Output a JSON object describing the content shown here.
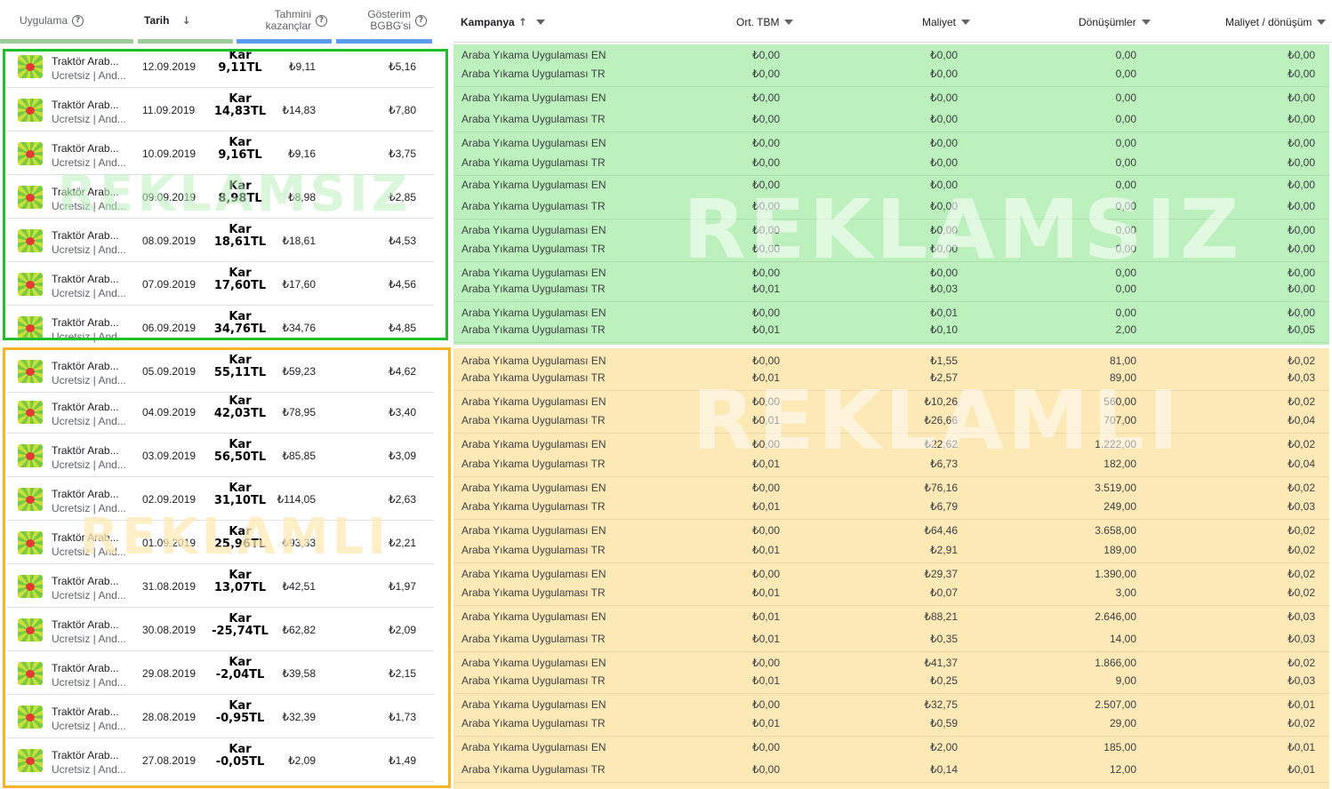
{
  "left_header": {
    "app": "Uygulama",
    "date": "Tarih",
    "earnings": "Tahmini kazançlar",
    "bgbg": "Gösterim BGBG'si"
  },
  "watermarks": {
    "no_ads": "REKLAMSIZ",
    "ads": "REKLAMLI"
  },
  "left_rows": [
    {
      "name": "Traktör Arab...",
      "sub": "Ucretsiz | And...",
      "date": "12.09.2019",
      "kar": "Kar",
      "profit": "9,11TL",
      "earn": "₺9,11",
      "bgbg": "₺5,16"
    },
    {
      "name": "Traktör Arab...",
      "sub": "Ucretsiz | And...",
      "date": "11.09.2019",
      "kar": "Kar",
      "profit": "14,83TL",
      "earn": "₺14,83",
      "bgbg": "₺7,80"
    },
    {
      "name": "Traktör Arab...",
      "sub": "Ucretsiz | And...",
      "date": "10.09.2019",
      "kar": "Kar",
      "profit": "9,16TL",
      "earn": "₺9,16",
      "bgbg": "₺3,75"
    },
    {
      "name": "Traktör Arab...",
      "sub": "Ucretsiz | And...",
      "date": "09.09.2019",
      "kar": "Kar",
      "profit": "8,98TL",
      "earn": "₺8,98",
      "bgbg": "₺2,85"
    },
    {
      "name": "Traktör Arab...",
      "sub": "Ucretsiz | And...",
      "date": "08.09.2019",
      "kar": "Kar",
      "profit": "18,61TL",
      "earn": "₺18,61",
      "bgbg": "₺4,53"
    },
    {
      "name": "Traktör Arab...",
      "sub": "Ucretsiz | And...",
      "date": "07.09.2019",
      "kar": "Kar",
      "profit": "17,60TL",
      "earn": "₺17,60",
      "bgbg": "₺4,56"
    },
    {
      "name": "Traktör Arab...",
      "sub": "Ucretsiz | And...",
      "date": "06.09.2019",
      "kar": "Kar",
      "profit": "34,76TL",
      "earn": "₺34,76",
      "bgbg": "₺4,85"
    },
    {
      "name": "Traktör Arab...",
      "sub": "Ucretsiz | And...",
      "date": "05.09.2019",
      "kar": "Kar",
      "profit": "55,11TL",
      "earn": "₺59,23",
      "bgbg": "₺4,62"
    },
    {
      "name": "Traktör Arab...",
      "sub": "Ucretsiz | And...",
      "date": "04.09.2019",
      "kar": "Kar",
      "profit": "42,03TL",
      "earn": "₺78,95",
      "bgbg": "₺3,40"
    },
    {
      "name": "Traktör Arab...",
      "sub": "Ucretsiz | And...",
      "date": "03.09.2019",
      "kar": "Kar",
      "profit": "56,50TL",
      "earn": "₺85,85",
      "bgbg": "₺3,09"
    },
    {
      "name": "Traktör Arab...",
      "sub": "Ucretsiz | And...",
      "date": "02.09.2019",
      "kar": "Kar",
      "profit": "31,10TL",
      "earn": "₺114,05",
      "bgbg": "₺2,63"
    },
    {
      "name": "Traktör Arab...",
      "sub": "Ucretsiz | And...",
      "date": "01.09.2019",
      "kar": "Kar",
      "profit": "25,96TL",
      "earn": "₺93,33",
      "bgbg": "₺2,21"
    },
    {
      "name": "Traktör Arab...",
      "sub": "Ucretsiz | And...",
      "date": "31.08.2019",
      "kar": "Kar",
      "profit": "13,07TL",
      "earn": "₺42,51",
      "bgbg": "₺1,97"
    },
    {
      "name": "Traktör Arab...",
      "sub": "Ucretsiz | And...",
      "date": "30.08.2019",
      "kar": "Kar",
      "profit": "-25,74TL",
      "earn": "₺62,82",
      "bgbg": "₺2,09"
    },
    {
      "name": "Traktör Arab...",
      "sub": "Ucretsiz | And...",
      "date": "29.08.2019",
      "kar": "Kar",
      "profit": "-2,04TL",
      "earn": "₺39,58",
      "bgbg": "₺2,15"
    },
    {
      "name": "Traktör Arab...",
      "sub": "Ucretsiz | And...",
      "date": "28.08.2019",
      "kar": "Kar",
      "profit": "-0,95TL",
      "earn": "₺32,39",
      "bgbg": "₺1,73"
    },
    {
      "name": "Traktör Arab...",
      "sub": "Ucretsiz | And...",
      "date": "27.08.2019",
      "kar": "Kar",
      "profit": "-0,05TL",
      "earn": "₺2,09",
      "bgbg": "₺1,49"
    }
  ],
  "right_header": {
    "campaign": "Kampanya",
    "tbm": "Ort. TBM",
    "cost": "Maliyet",
    "conversions": "Dönüşümler",
    "cpc": "Maliyet / dönüşüm"
  },
  "campaign_rows": [
    {
      "group": "green",
      "lines": [
        {
          "name": "Araba Yıkama Uygulaması EN",
          "tbm": "₺0,00",
          "cost": "₺0,00",
          "conv": "0,00",
          "cpc": "₺0,00"
        },
        {
          "name": "Araba Yıkama Uygulaması TR",
          "tbm": "₺0,00",
          "cost": "₺0,00",
          "conv": "0,00",
          "cpc": "₺0,00"
        }
      ]
    },
    {
      "group": "green",
      "lines": [
        {
          "name": "Araba Yıkama Uygulaması EN",
          "tbm": "₺0,00",
          "cost": "₺0,00",
          "conv": "0,00",
          "cpc": "₺0,00"
        },
        {
          "name": "Araba Yıkama Uygulaması TR",
          "tbm": "₺0,00",
          "cost": "₺0,00",
          "conv": "0,00",
          "cpc": "₺0,00"
        }
      ]
    },
    {
      "group": "green",
      "lines": [
        {
          "name": "Araba Yıkama Uygulaması EN",
          "tbm": "₺0,00",
          "cost": "₺0,00",
          "conv": "0,00",
          "cpc": "₺0,00"
        },
        {
          "name": "Araba Yıkama Uygulaması TR",
          "tbm": "₺0,00",
          "cost": "₺0,00",
          "conv": "0,00",
          "cpc": "₺0,00"
        }
      ]
    },
    {
      "group": "green",
      "lines": [
        {
          "name": "Araba Yıkama Uygulaması EN",
          "tbm": "₺0,00",
          "cost": "₺0,00",
          "conv": "0,00",
          "cpc": "₺0,00"
        },
        {
          "name": "Araba Yıkama Uygulaması TR",
          "tbm": "₺0,00",
          "cost": "₺0,00",
          "conv": "0,00",
          "cpc": "₺0,00"
        }
      ]
    },
    {
      "group": "green",
      "lines": [
        {
          "name": "Araba Yıkama Uygulaması EN",
          "tbm": "₺0,00",
          "cost": "₺0,00",
          "conv": "0,00",
          "cpc": "₺0,00"
        },
        {
          "name": "Araba Yıkama Uygulaması TR",
          "tbm": "₺0,00",
          "cost": "₺0,00",
          "conv": "0,00",
          "cpc": "₺0,00"
        }
      ]
    },
    {
      "group": "green",
      "lines": [
        {
          "name": "Araba Yıkama Uygulaması EN",
          "tbm": "₺0,00",
          "cost": "₺0,00",
          "conv": "0,00",
          "cpc": "₺0,00"
        },
        {
          "name": "Araba Yıkama Uygulaması TR",
          "tbm": "₺0,01",
          "cost": "₺0,03",
          "conv": "0,00",
          "cpc": "₺0,00"
        }
      ]
    },
    {
      "group": "green",
      "lines": [
        {
          "name": "Araba Yıkama Uygulaması EN",
          "tbm": "₺0,00",
          "cost": "₺0,01",
          "conv": "0,00",
          "cpc": "₺0,00"
        },
        {
          "name": "Araba Yıkama Uygulaması TR",
          "tbm": "₺0,01",
          "cost": "₺0,10",
          "conv": "2,00",
          "cpc": "₺0,05"
        }
      ]
    },
    {
      "group": "orange",
      "lines": [
        {
          "name": "Araba Yıkama Uygulaması EN",
          "tbm": "₺0,00",
          "cost": "₺1,55",
          "conv": "81,00",
          "cpc": "₺0,02"
        },
        {
          "name": "Araba Yıkama Uygulaması TR",
          "tbm": "₺0,01",
          "cost": "₺2,57",
          "conv": "89,00",
          "cpc": "₺0,03"
        }
      ]
    },
    {
      "group": "orange",
      "lines": [
        {
          "name": "Araba Yıkama Uygulaması EN",
          "tbm": "₺0,00",
          "cost": "₺10,26",
          "conv": "560,00",
          "cpc": "₺0,02"
        },
        {
          "name": "Araba Yıkama Uygulaması TR",
          "tbm": "₺0,01",
          "cost": "₺26,66",
          "conv": "707,00",
          "cpc": "₺0,04"
        }
      ]
    },
    {
      "group": "orange",
      "lines": [
        {
          "name": "Araba Yıkama Uygulaması EN",
          "tbm": "₺0,00",
          "cost": "₺22,62",
          "conv": "1.222,00",
          "cpc": "₺0,02"
        },
        {
          "name": "Araba Yıkama Uygulaması TR",
          "tbm": "₺0,01",
          "cost": "₺6,73",
          "conv": "182,00",
          "cpc": "₺0,04"
        }
      ]
    },
    {
      "group": "orange",
      "lines": [
        {
          "name": "Araba Yıkama Uygulaması EN",
          "tbm": "₺0,00",
          "cost": "₺76,16",
          "conv": "3.519,00",
          "cpc": "₺0,02"
        },
        {
          "name": "Araba Yıkama Uygulaması TR",
          "tbm": "₺0,01",
          "cost": "₺6,79",
          "conv": "249,00",
          "cpc": "₺0,03"
        }
      ]
    },
    {
      "group": "orange",
      "lines": [
        {
          "name": "Araba Yıkama Uygulaması EN",
          "tbm": "₺0,00",
          "cost": "₺64,46",
          "conv": "3.658,00",
          "cpc": "₺0,02"
        },
        {
          "name": "Araba Yıkama Uygulaması TR",
          "tbm": "₺0,01",
          "cost": "₺2,91",
          "conv": "189,00",
          "cpc": "₺0,02"
        }
      ]
    },
    {
      "group": "orange",
      "lines": [
        {
          "name": "Araba Yıkama Uygulaması EN",
          "tbm": "₺0,00",
          "cost": "₺29,37",
          "conv": "1.390,00",
          "cpc": "₺0,02"
        },
        {
          "name": "Araba Yıkama Uygulaması TR",
          "tbm": "₺0,01",
          "cost": "₺0,07",
          "conv": "3,00",
          "cpc": "₺0,02"
        }
      ]
    },
    {
      "group": "orange",
      "lines": [
        {
          "name": "Araba Yıkama Uygulaması EN",
          "tbm": "₺0,01",
          "cost": "₺88,21",
          "conv": "2.646,00",
          "cpc": "₺0,03"
        },
        {
          "name": "Araba Yıkama Uygulaması TR",
          "tbm": "₺0,01",
          "cost": "₺0,35",
          "conv": "14,00",
          "cpc": "₺0,03"
        }
      ]
    },
    {
      "group": "orange",
      "lines": [
        {
          "name": "Araba Yıkama Uygulaması EN",
          "tbm": "₺0,00",
          "cost": "₺41,37",
          "conv": "1.866,00",
          "cpc": "₺0,02"
        },
        {
          "name": "Araba Yıkama Uygulaması TR",
          "tbm": "₺0,01",
          "cost": "₺0,25",
          "conv": "9,00",
          "cpc": "₺0,03"
        }
      ]
    },
    {
      "group": "orange",
      "lines": [
        {
          "name": "Araba Yıkama Uygulaması EN",
          "tbm": "₺0,00",
          "cost": "₺32,75",
          "conv": "2.507,00",
          "cpc": "₺0,01"
        },
        {
          "name": "Araba Yıkama Uygulaması TR",
          "tbm": "₺0,01",
          "cost": "₺0,59",
          "conv": "29,00",
          "cpc": "₺0,02"
        }
      ]
    },
    {
      "group": "orange",
      "lines": [
        {
          "name": "Araba Yıkama Uygulaması EN",
          "tbm": "₺0,00",
          "cost": "₺2,00",
          "conv": "185,00",
          "cpc": "₺0,01"
        },
        {
          "name": "Araba Yıkama Uygulaması TR",
          "tbm": "₺0,00",
          "cost": "₺0,14",
          "conv": "12,00",
          "cpc": "₺0,01"
        }
      ]
    }
  ],
  "colors": {
    "green_box": "#1fbf2b",
    "orange_box": "#f5b325",
    "green_band": "#bcf0bd",
    "orange_band": "#fde9b6"
  }
}
